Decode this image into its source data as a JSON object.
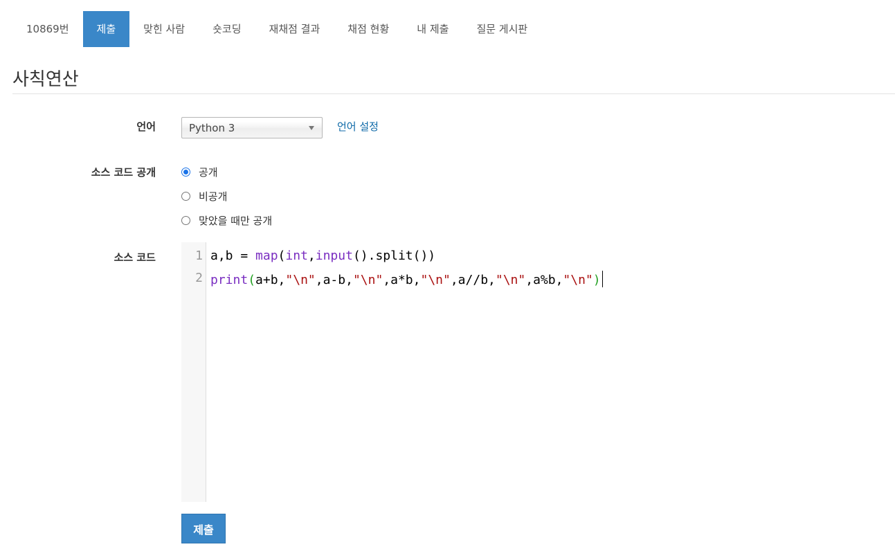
{
  "nav": {
    "tabs": [
      {
        "label": "10869번",
        "active": false
      },
      {
        "label": "제출",
        "active": true
      },
      {
        "label": "맞힌 사람",
        "active": false
      },
      {
        "label": "숏코딩",
        "active": false
      },
      {
        "label": "재채점 결과",
        "active": false
      },
      {
        "label": "채점 현황",
        "active": false
      },
      {
        "label": "내 제출",
        "active": false
      },
      {
        "label": "질문 게시판",
        "active": false
      }
    ]
  },
  "problem": {
    "title": "사칙연산"
  },
  "form": {
    "language_label": "언어",
    "language_value": "Python 3",
    "language_settings_link": "언어 설정",
    "visibility_label": "소스 코드 공개",
    "visibility_options": [
      {
        "label": "공개",
        "checked": true
      },
      {
        "label": "비공개",
        "checked": false
      },
      {
        "label": "맞았을 때만 공개",
        "checked": false
      }
    ],
    "source_label": "소스 코드",
    "submit_label": "제출"
  },
  "editor": {
    "line_numbers": [
      "1",
      "2"
    ],
    "lines": [
      [
        {
          "text": "a,b = ",
          "type": "plain"
        },
        {
          "text": "map",
          "type": "kw"
        },
        {
          "text": "(",
          "type": "plain"
        },
        {
          "text": "int",
          "type": "kw"
        },
        {
          "text": ",",
          "type": "plain"
        },
        {
          "text": "input",
          "type": "kw"
        },
        {
          "text": "().split())",
          "type": "plain"
        }
      ],
      [
        {
          "text": "print",
          "type": "kw"
        },
        {
          "text": "(",
          "type": "cursor-par"
        },
        {
          "text": "a+b,",
          "type": "plain"
        },
        {
          "text": "\"\\n\"",
          "type": "str"
        },
        {
          "text": ",a-b,",
          "type": "plain"
        },
        {
          "text": "\"\\n\"",
          "type": "str"
        },
        {
          "text": ",a*b,",
          "type": "plain"
        },
        {
          "text": "\"\\n\"",
          "type": "str"
        },
        {
          "text": ",a//b,",
          "type": "plain"
        },
        {
          "text": "\"\\n\"",
          "type": "str"
        },
        {
          "text": ",a%b,",
          "type": "plain"
        },
        {
          "text": "\"\\n\"",
          "type": "str"
        },
        {
          "text": ")",
          "type": "cursor-par"
        }
      ]
    ]
  },
  "colors": {
    "accent": "#3a87c8",
    "link": "#0f6aa8",
    "keyword": "#7a2ec1",
    "string": "#aa1111"
  }
}
